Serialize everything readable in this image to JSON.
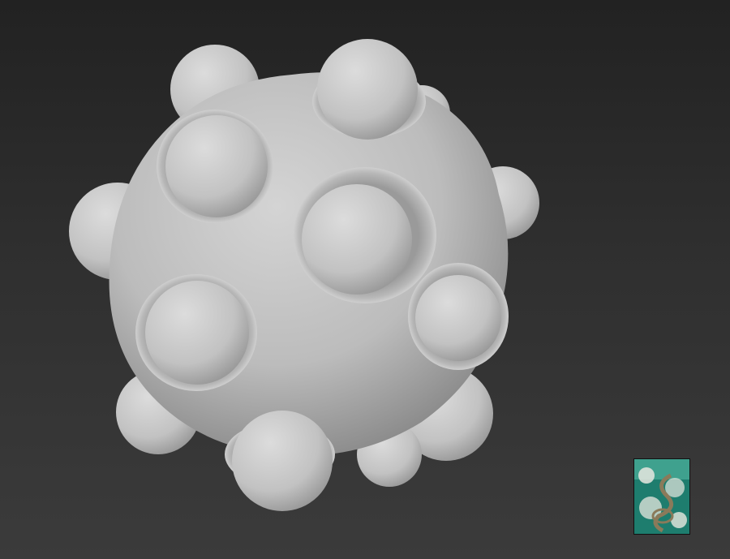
{
  "viewport": {
    "background_top": "#222222",
    "background_bottom": "#3b3b3b"
  },
  "model": {
    "icon": "sphere-cluster-model",
    "base_color": "#bdbdbd",
    "shadow_color": "#6e6e6e"
  },
  "thumbnail": {
    "icon": "texture-preview-thumbnail",
    "colors": [
      "#1e7d6e",
      "#e8e8e0",
      "#3fa18e",
      "#8a7a5a"
    ]
  }
}
